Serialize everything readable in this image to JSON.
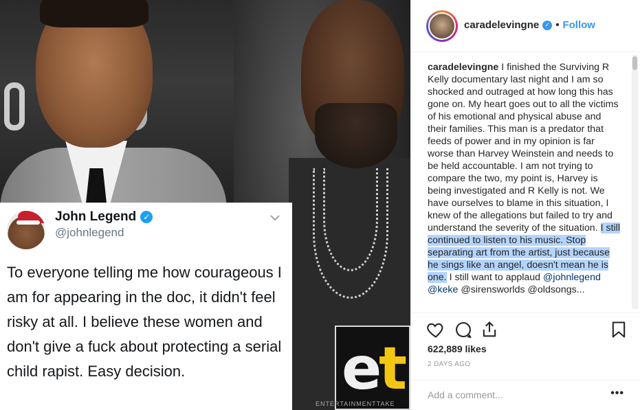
{
  "post_image": {
    "tweet": {
      "name": "John Legend",
      "handle": "@johnlegend",
      "text": "To everyone telling me how courageous I am for appearing in the doc, it didn't feel risky at all. I believe these women and don't give a fuck about protecting a serial child rapist. Easy decision."
    },
    "watermark": {
      "letter_e": "e",
      "letter_t": "t",
      "strip_text": "ENTERTAINMENTTAKE"
    }
  },
  "header": {
    "username": "caradelevingne",
    "separator": "•",
    "follow_label": "Follow"
  },
  "caption": {
    "username": "caradelevingne",
    "text_before": " I finished the Surviving R Kelly documentary last night and I am so shocked and outraged at how long this has gone on. My heart goes out to all the victims of his emotional and physical abuse and their families. This man is a predator that feeds of power and in my opinion is far worse than Harvey Weinstein and needs to be held accountable. I am not trying to compare the two, my point is, Harvey is being investigated and R Kelly is not. We have ourselves to blame in this situation, I knew of the allegations but failed to try and understand the severity of the situation. ",
    "text_highlighted": "I still continued to listen to his music. Stop separating art from the artist, just because he sings like an angel, doesn't mean he is one.",
    "text_after": " I still want to applaud ",
    "mention_1": "@johnlegend",
    "mention_2": "@keke",
    "text_tail": " @sirensworlds @oldsongs..."
  },
  "actions": {
    "like_icon": "heart-icon",
    "comment_icon": "comment-icon",
    "share_icon": "share-icon",
    "save_icon": "bookmark-icon"
  },
  "likes": "622,889 likes",
  "date": "2 DAYS AGO",
  "comment": {
    "placeholder": "Add a comment...",
    "more_label": "•••"
  },
  "colors": {
    "link_blue": "#3897f0",
    "highlight": "#b3d4fc",
    "twitter_blue": "#1da1f2",
    "et_yellow": "#f3c613"
  }
}
